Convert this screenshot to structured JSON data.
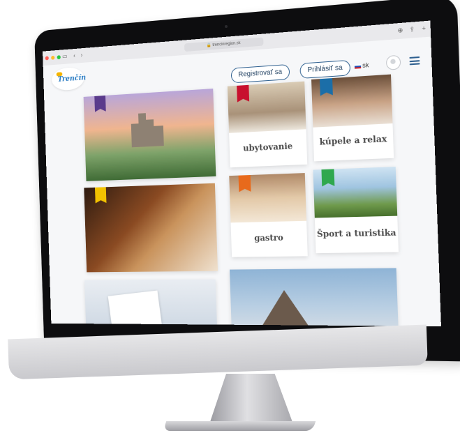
{
  "browser": {
    "url": "trencinregion.sk",
    "traffic_lights": [
      "#ff5f57",
      "#febc2e",
      "#28c840"
    ]
  },
  "header": {
    "logo_text": "Trenčín",
    "register_label": "Registrovať sa",
    "login_label": "Prihlásiť sa",
    "language": "sk"
  },
  "tiles": [
    {
      "label": "",
      "badge_color": "#5a3b8c",
      "badge_icon": "castle-icon"
    },
    {
      "label": "ubytovanie",
      "badge_color": "#c8102e",
      "badge_icon": "bed-icon"
    },
    {
      "label": "kúpele a relax",
      "badge_color": "#1b6ea8",
      "badge_icon": "lotus-icon"
    },
    {
      "label": "",
      "badge_color": "#f2c200",
      "badge_icon": "eye-icon"
    },
    {
      "label": "gastro",
      "badge_color": "#e86a1c",
      "badge_icon": "cutlery-icon"
    },
    {
      "label": "Šport a turistika",
      "badge_color": "#2fa84f",
      "badge_icon": "compass-icon"
    },
    {
      "label": "",
      "badge_color": "",
      "badge_icon": ""
    },
    {
      "label": "",
      "badge_color": "",
      "badge_icon": ""
    }
  ]
}
